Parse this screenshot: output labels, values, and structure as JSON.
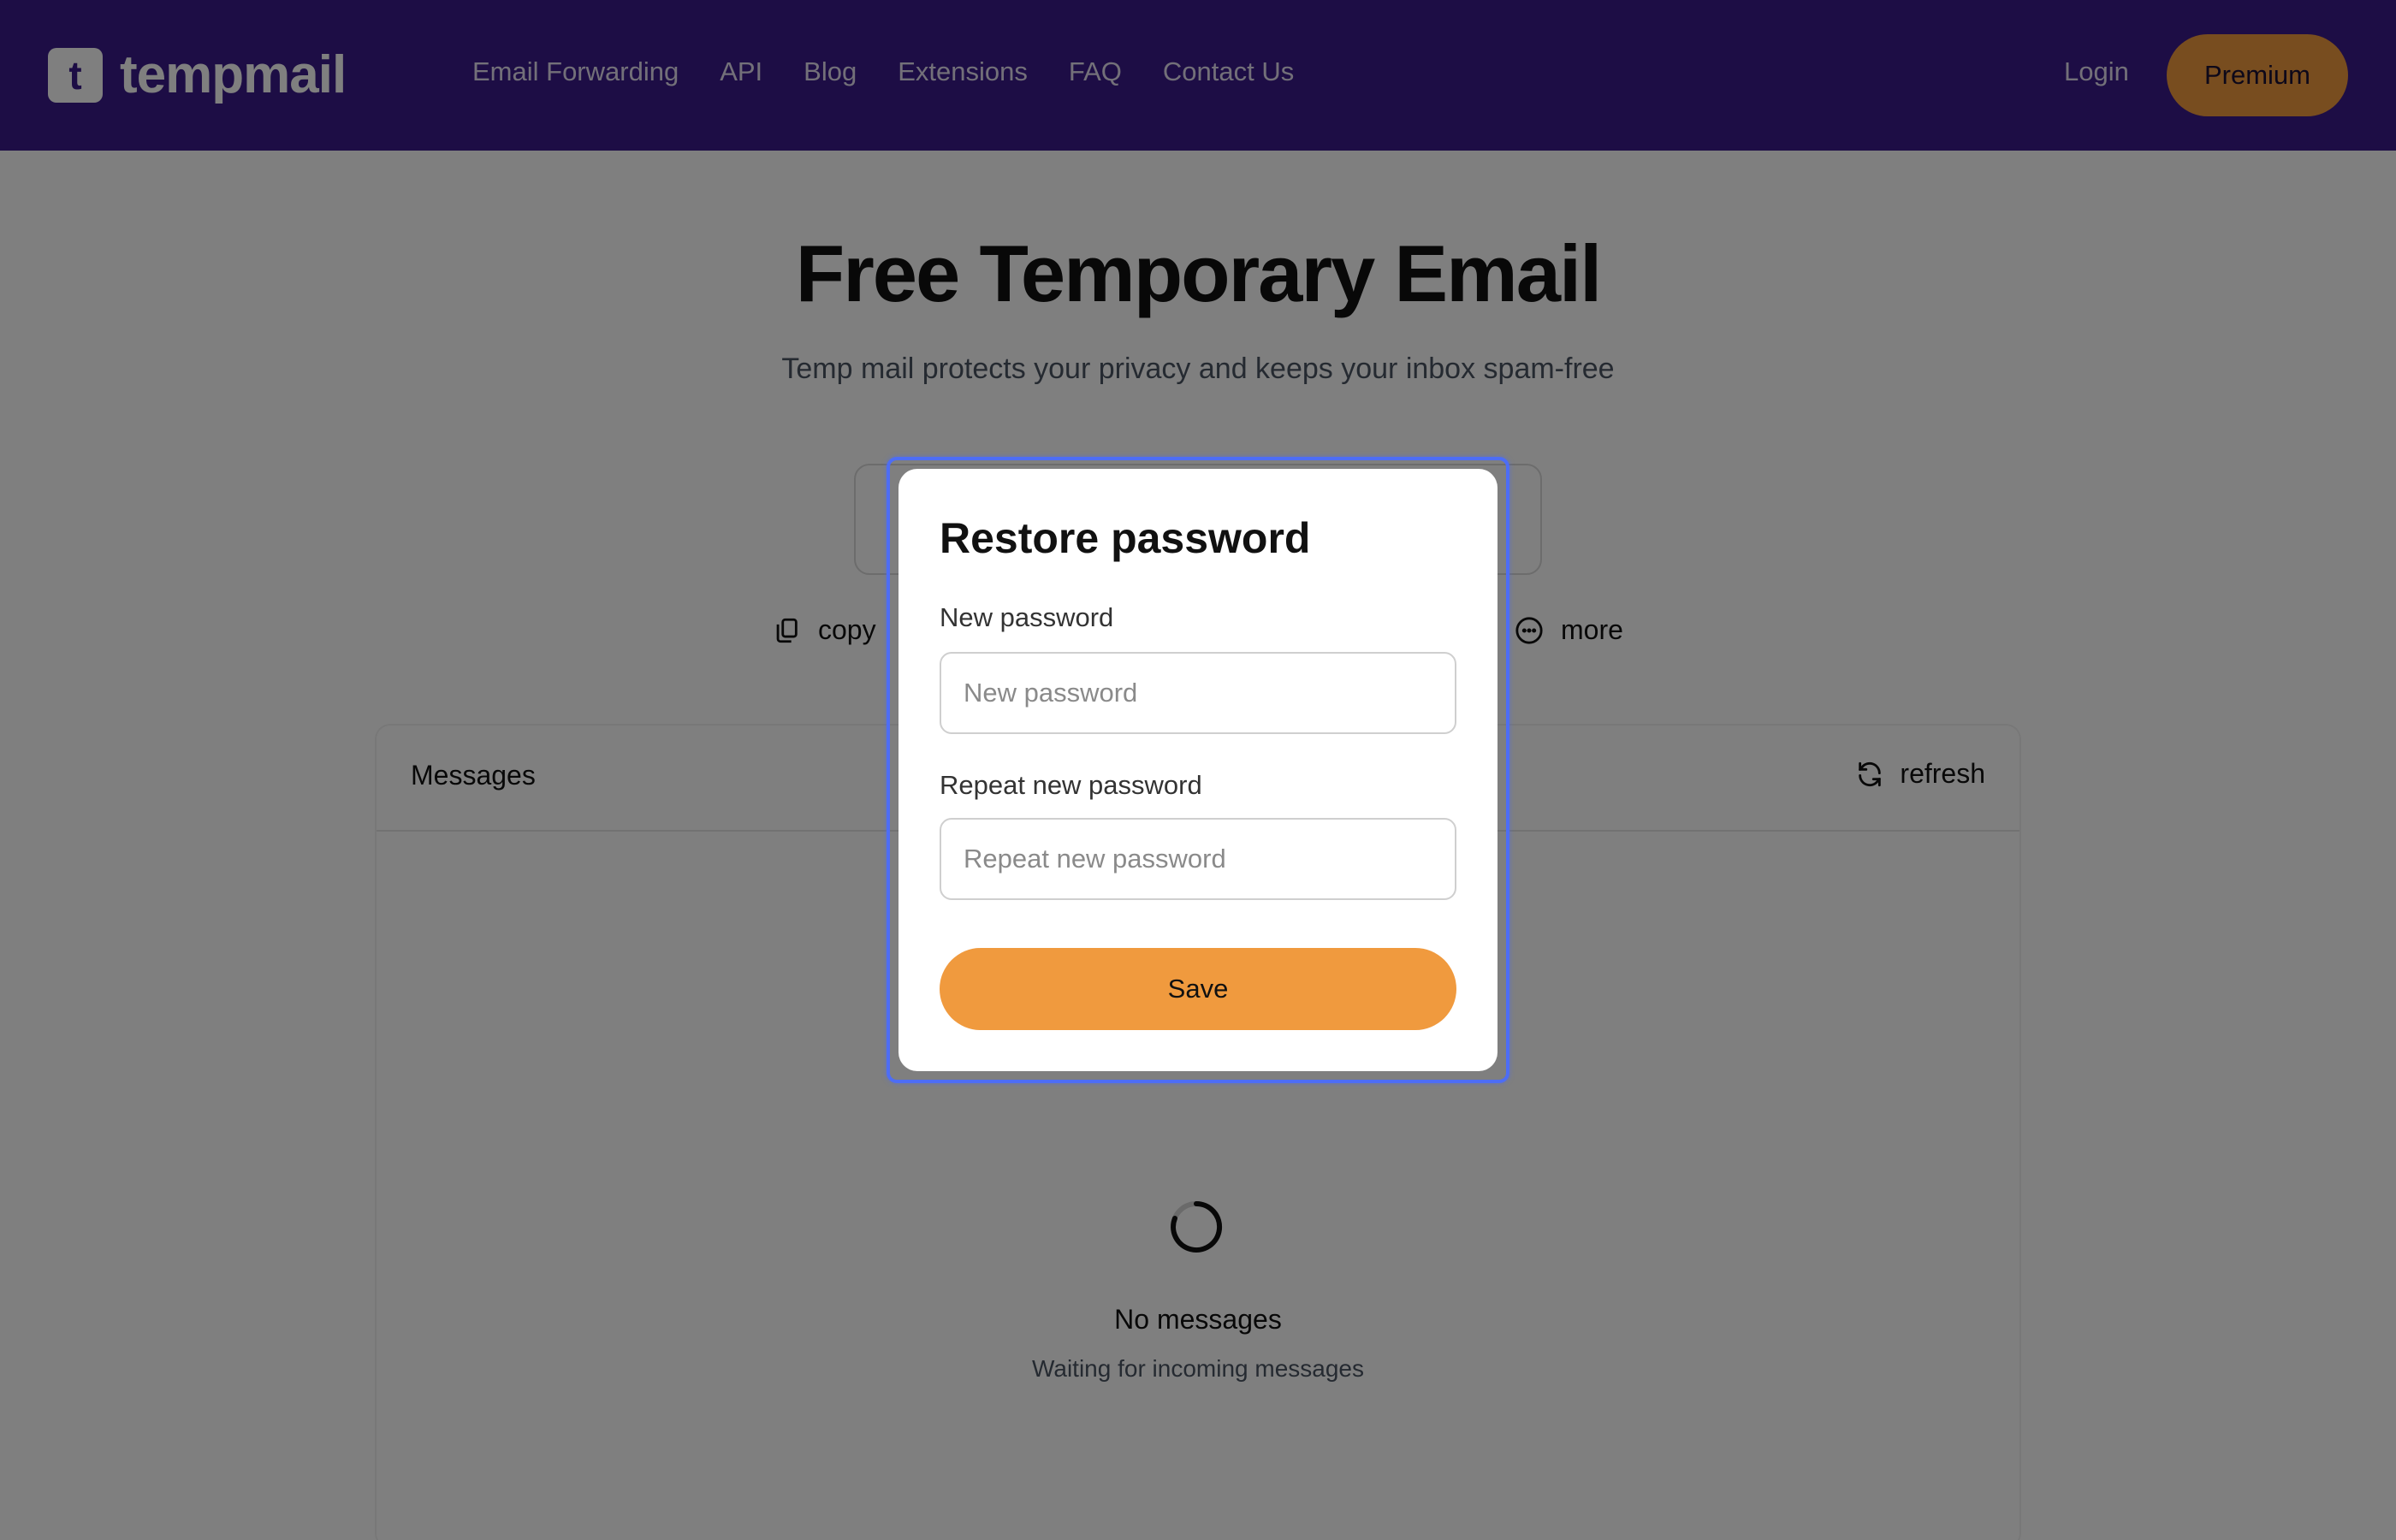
{
  "header": {
    "logo_mark": "t",
    "logo_text": "tempmail",
    "nav": [
      "Email Forwarding",
      "API",
      "Blog",
      "Extensions",
      "FAQ",
      "Contact Us"
    ],
    "login": "Login",
    "premium": "Premium"
  },
  "hero": {
    "title": "Free Temporary Email",
    "subtitle": "Temp mail protects your privacy and keeps your inbox spam-free"
  },
  "actions": {
    "copy": "copy",
    "more": "more"
  },
  "messages": {
    "title": "Messages",
    "refresh": "refresh",
    "empty_title": "No messages",
    "empty_sub": "Waiting for incoming messages"
  },
  "modal": {
    "title": "Restore password",
    "new_label": "New password",
    "new_placeholder": "New password",
    "repeat_label": "Repeat new password",
    "repeat_placeholder": "Repeat new password",
    "save": "Save"
  },
  "colors": {
    "header_bg": "#3b1a8a",
    "accent": "#f09a3e",
    "focus_ring": "#4d6df5"
  }
}
